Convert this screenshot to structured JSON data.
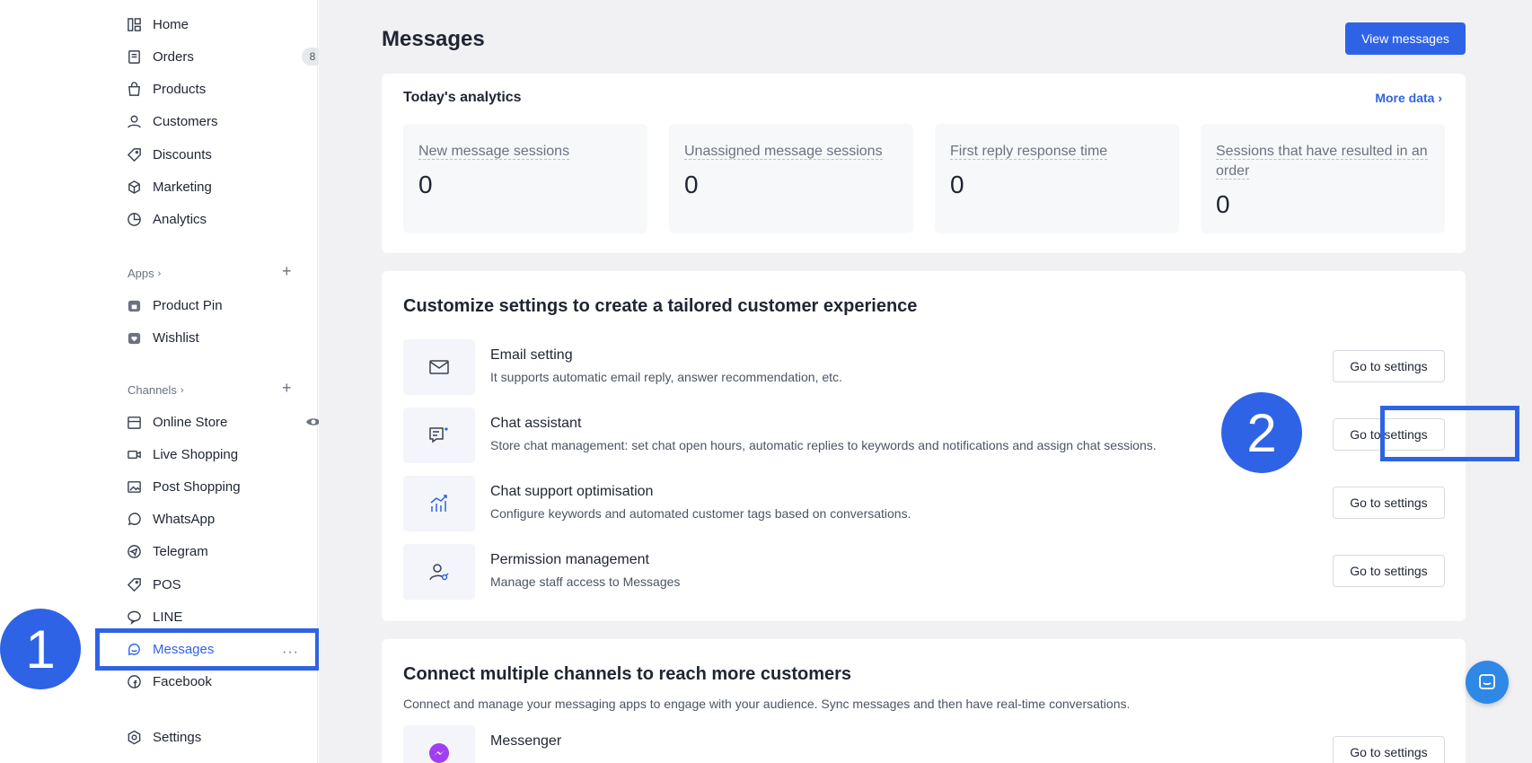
{
  "sidebar": {
    "items": [
      {
        "label": "Home"
      },
      {
        "label": "Orders",
        "badge": "8"
      },
      {
        "label": "Products"
      },
      {
        "label": "Customers"
      },
      {
        "label": "Discounts"
      },
      {
        "label": "Marketing"
      },
      {
        "label": "Analytics"
      }
    ],
    "apps_heading": "Apps",
    "apps": [
      {
        "label": "Product Pin"
      },
      {
        "label": "Wishlist"
      }
    ],
    "channels_heading": "Channels",
    "channels": [
      {
        "label": "Online Store"
      },
      {
        "label": "Live Shopping"
      },
      {
        "label": "Post Shopping"
      },
      {
        "label": "WhatsApp"
      },
      {
        "label": "Telegram"
      },
      {
        "label": "POS"
      },
      {
        "label": "LINE"
      },
      {
        "label": "Messages"
      },
      {
        "label": "Facebook"
      }
    ],
    "settings_label": "Settings"
  },
  "header": {
    "title": "Messages",
    "view_button": "View messages"
  },
  "analytics": {
    "title": "Today's analytics",
    "more_link": "More data",
    "stats": [
      {
        "label": "New message sessions",
        "value": "0"
      },
      {
        "label": "Unassigned message sessions",
        "value": "0"
      },
      {
        "label": "First reply response time",
        "value": "0"
      },
      {
        "label": "Sessions that have resulted in an order",
        "value": "0"
      }
    ]
  },
  "customize": {
    "title": "Customize settings to create a tailored customer experience",
    "items": [
      {
        "name": "Email setting",
        "desc": "It supports automatic email reply, answer recommendation, etc.",
        "button": "Go to settings"
      },
      {
        "name": "Chat assistant",
        "desc": "Store chat management: set chat open hours, automatic replies to keywords and notifications and assign chat sessions.",
        "button": "Go to settings"
      },
      {
        "name": "Chat support optimisation",
        "desc": "Configure keywords and automated customer tags based on conversations.",
        "button": "Go to settings"
      },
      {
        "name": "Permission management",
        "desc": "Manage staff access to Messages",
        "button": "Go to settings"
      }
    ]
  },
  "connect": {
    "title": "Connect multiple channels to reach more customers",
    "desc": "Connect and manage your messaging apps to engage with your audience. Sync messages and then have real-time conversations.",
    "items": [
      {
        "name": "Messenger",
        "button": "Go to settings"
      }
    ]
  },
  "annotations": {
    "step1": "1",
    "step2": "2"
  },
  "colors": {
    "accent": "#2f63e6",
    "background": "#f1f1f4"
  }
}
